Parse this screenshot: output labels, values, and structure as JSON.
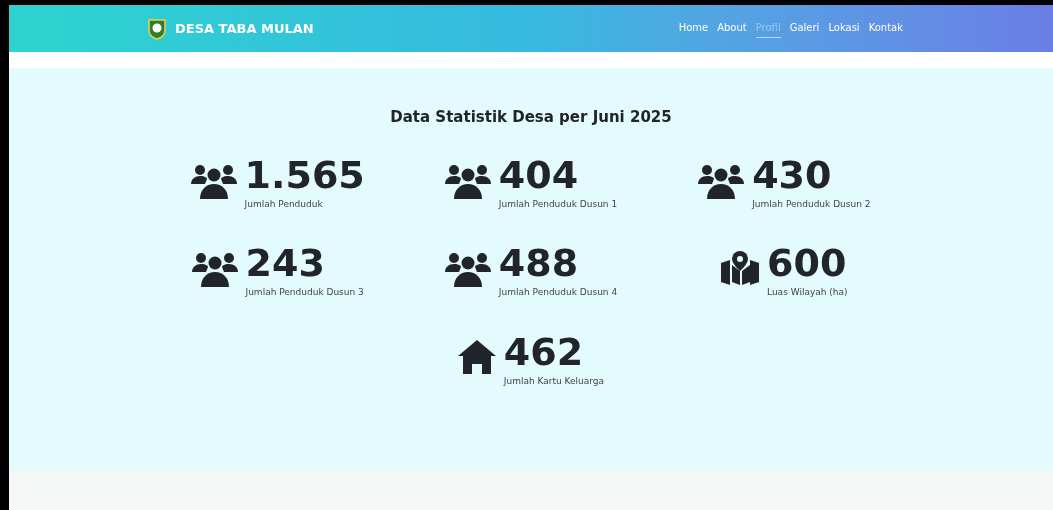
{
  "navbar": {
    "brand": "DESA TABA MULAN",
    "links": [
      {
        "label": "Home",
        "selected": false
      },
      {
        "label": "About",
        "selected": false
      },
      {
        "label": "Profil",
        "selected": true
      },
      {
        "label": "Galeri",
        "selected": false
      },
      {
        "label": "Lokasi",
        "selected": false
      },
      {
        "label": "Kontak",
        "selected": false
      }
    ]
  },
  "stats_section": {
    "title": "Data Statistik Desa per Juni 2025",
    "stats": [
      {
        "kind": "people",
        "value": "1.565",
        "label": "Jumlah Penduduk"
      },
      {
        "kind": "people",
        "value": "404",
        "label": "Jumlah Penduduk Dusun 1"
      },
      {
        "kind": "people",
        "value": "430",
        "label": "Jumlah Penduduk Dusun 2"
      },
      {
        "kind": "people",
        "value": "243",
        "label": "Jumlah Penduduk Dusun 3"
      },
      {
        "kind": "people",
        "value": "488",
        "label": "Jumlah Penduduk Dusun 4"
      },
      {
        "kind": "map",
        "value": "600",
        "label": "Luas Wilayah (ha)"
      },
      {
        "kind": "home",
        "value": "462",
        "label": "Jumlah Kartu Keluarga"
      }
    ]
  }
}
